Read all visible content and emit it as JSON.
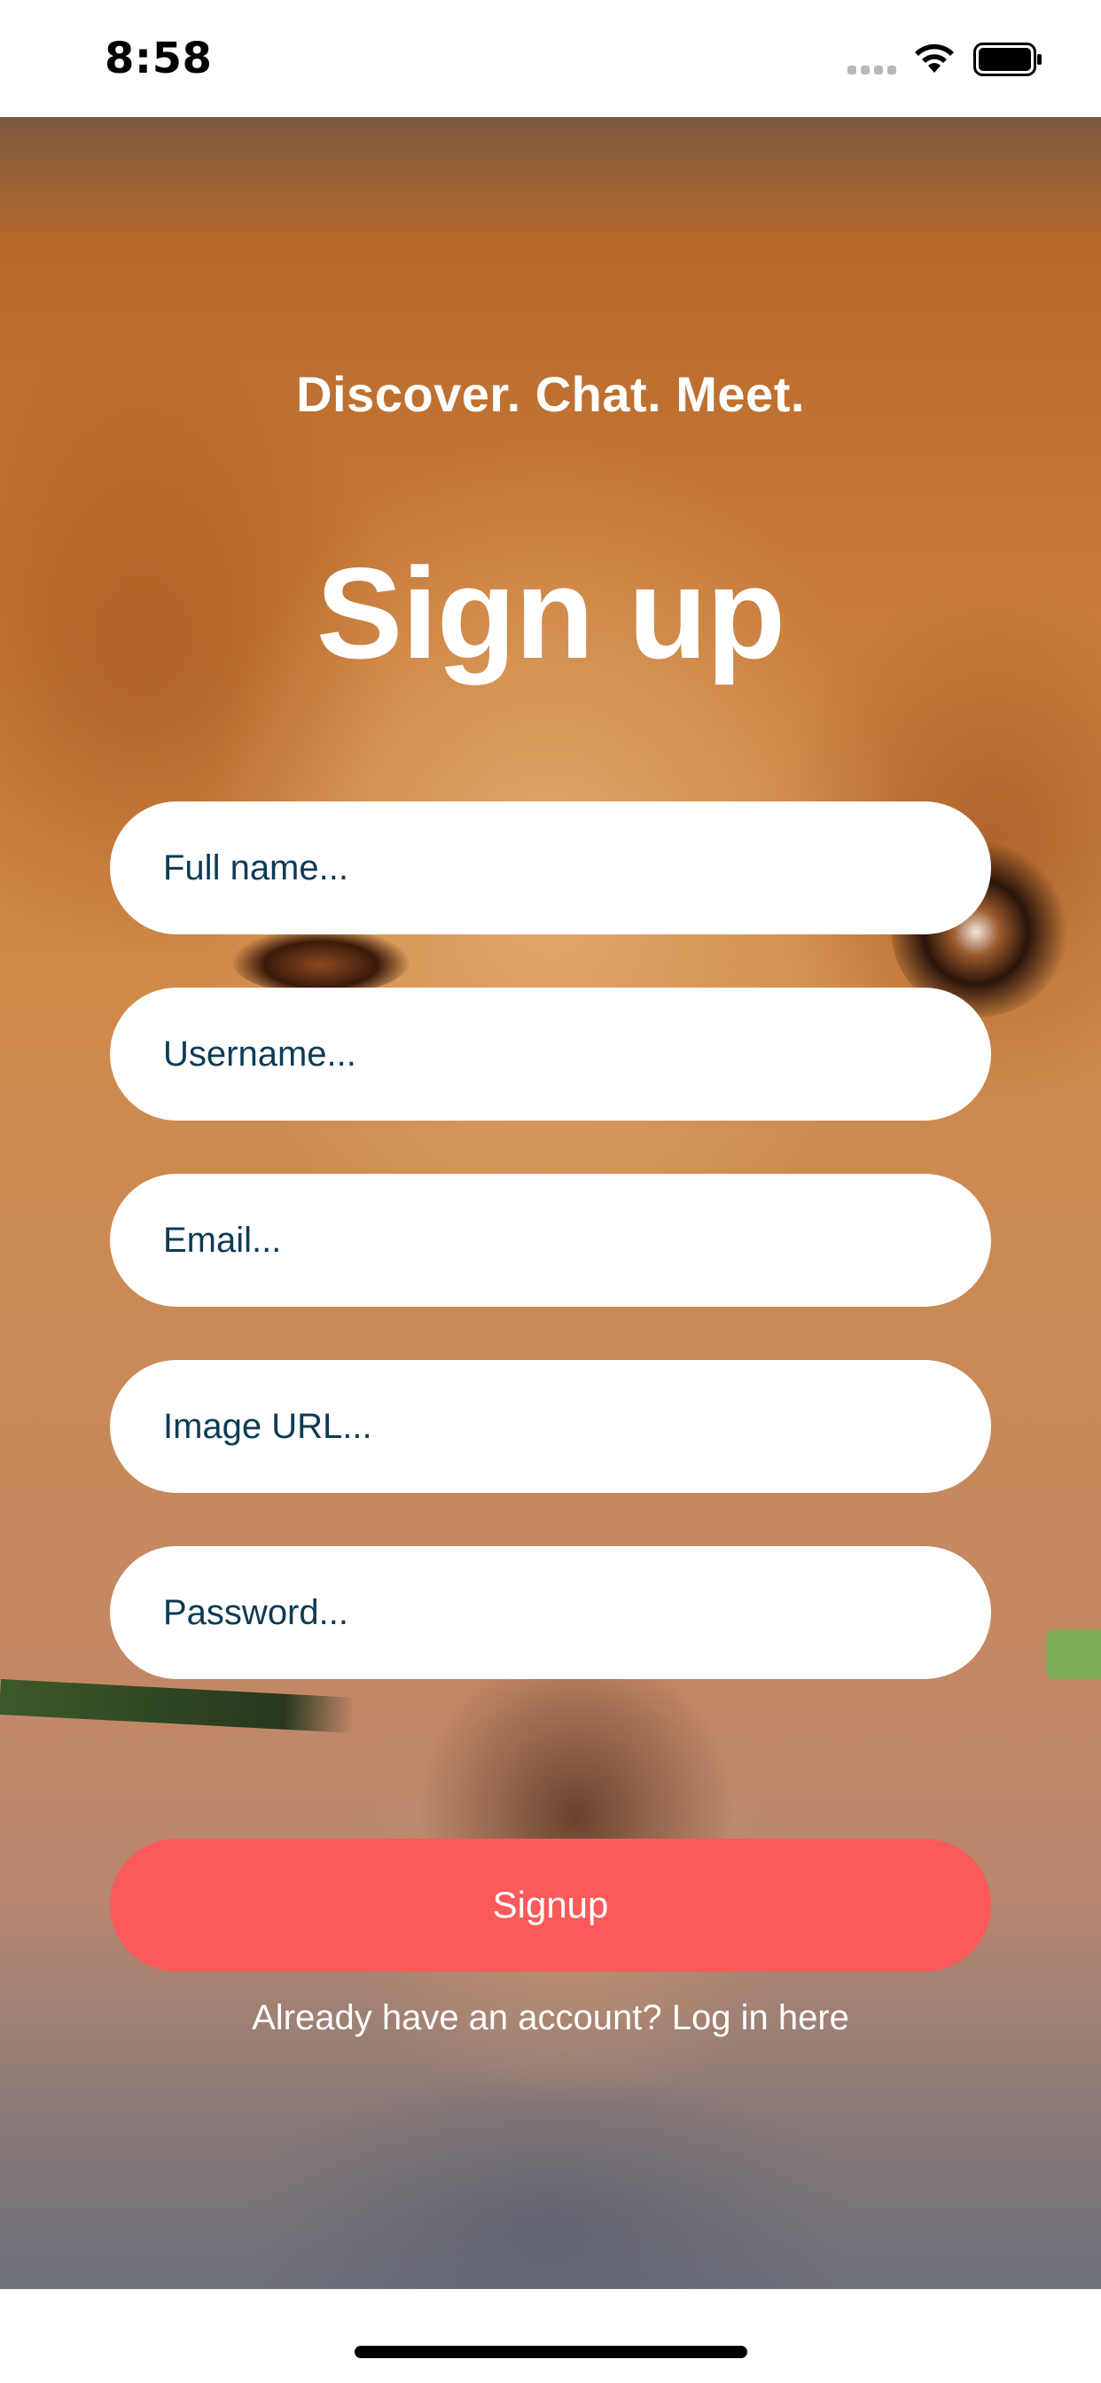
{
  "status_bar": {
    "time": "8:58",
    "icons": [
      "signal-dots-icon",
      "wifi-icon",
      "battery-icon"
    ]
  },
  "hero": {
    "tagline": "Discover. Chat. Meet.",
    "title": "Sign up"
  },
  "form": {
    "fields": [
      {
        "name": "full-name",
        "placeholder": "Full name...",
        "value": ""
      },
      {
        "name": "username",
        "placeholder": "Username...",
        "value": ""
      },
      {
        "name": "email",
        "placeholder": "Email...",
        "value": ""
      },
      {
        "name": "image-url",
        "placeholder": "Image URL...",
        "value": ""
      },
      {
        "name": "password",
        "placeholder": "Password...",
        "value": ""
      }
    ],
    "submit_label": "Signup",
    "login_prompt": "Already have an account? Log in here"
  },
  "colors": {
    "accent": "#fb5a5a",
    "input_text": "#0d3b55",
    "input_background": "#ffffff",
    "heading_text": "#ffffff"
  }
}
